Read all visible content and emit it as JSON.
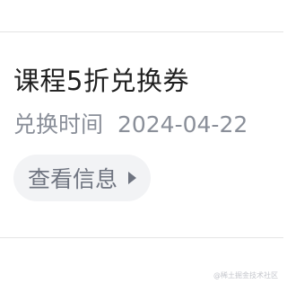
{
  "coupon": {
    "title": "课程5折兑换券",
    "redeem_label": "兑换时间",
    "redeem_date": "2024-04-22",
    "info_button_label": "查看信息"
  },
  "watermark": {
    "text": "@稀土掘金技术社区"
  },
  "icons": {
    "info_caret": "caret-right-icon"
  },
  "colors": {
    "title": "#1f1f1f",
    "meta": "#8a8f99",
    "button_bg": "#f2f3f5",
    "divider": "#e4e4e4"
  }
}
